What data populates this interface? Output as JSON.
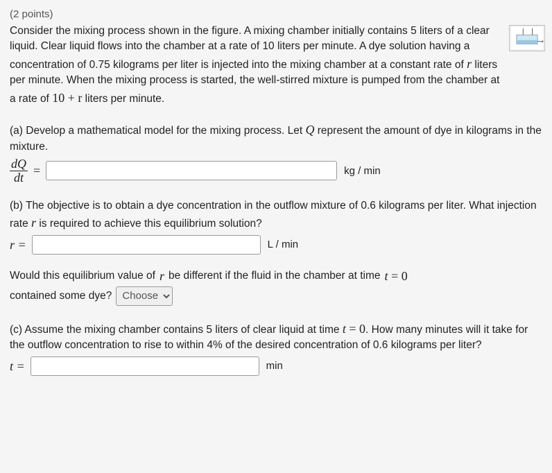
{
  "points_label": "(2 points)",
  "intro": {
    "p1_a": "Consider the mixing process shown in the figure. A mixing chamber initially contains 5 liters of a clear liquid. Clear liquid flows into the chamber at a rate of 10 liters per minute. A dye solution having a concentration of 0.75 kilograms per liter is injected into the mixing chamber at a constant rate of ",
    "p1_var": "r",
    "p1_b": " liters per minute. When the mixing process is started, the well-stirred mixture is pumped from the chamber at a rate of ",
    "p1_expr": "10 + r",
    "p1_c": " liters per minute."
  },
  "part_a": {
    "text_a": "(a) Develop a mathematical model for the mixing process. Let ",
    "var": "Q",
    "text_b": " represent the amount of dye in kilograms in the mixture.",
    "frac_num": "dQ",
    "frac_den": "dt",
    "unit": "kg / min"
  },
  "part_b": {
    "text_a": "(b) The objective is to obtain a dye concentration in the outflow mixture of 0.6 kilograms per liter. What injection rate ",
    "var": "r",
    "text_b": " is required to achieve this equilibrium solution?",
    "lhs": "r =",
    "unit": "L / min",
    "follow_a": "Would this equilibrium value of ",
    "follow_var": "r",
    "follow_b": " be different if the fluid in the chamber at time ",
    "follow_expr": "t = 0",
    "follow_c": " contained some dye?",
    "select_placeholder": "Choose"
  },
  "part_c": {
    "text_a": "(c) Assume the mixing chamber contains 5 liters of clear liquid at time ",
    "expr": "t = 0",
    "text_b": ". How many minutes will it take for the outflow concentration to rise to within 4% of the desired concentration of 0.6 kilograms per liter?",
    "lhs": "t =",
    "unit": "min"
  }
}
